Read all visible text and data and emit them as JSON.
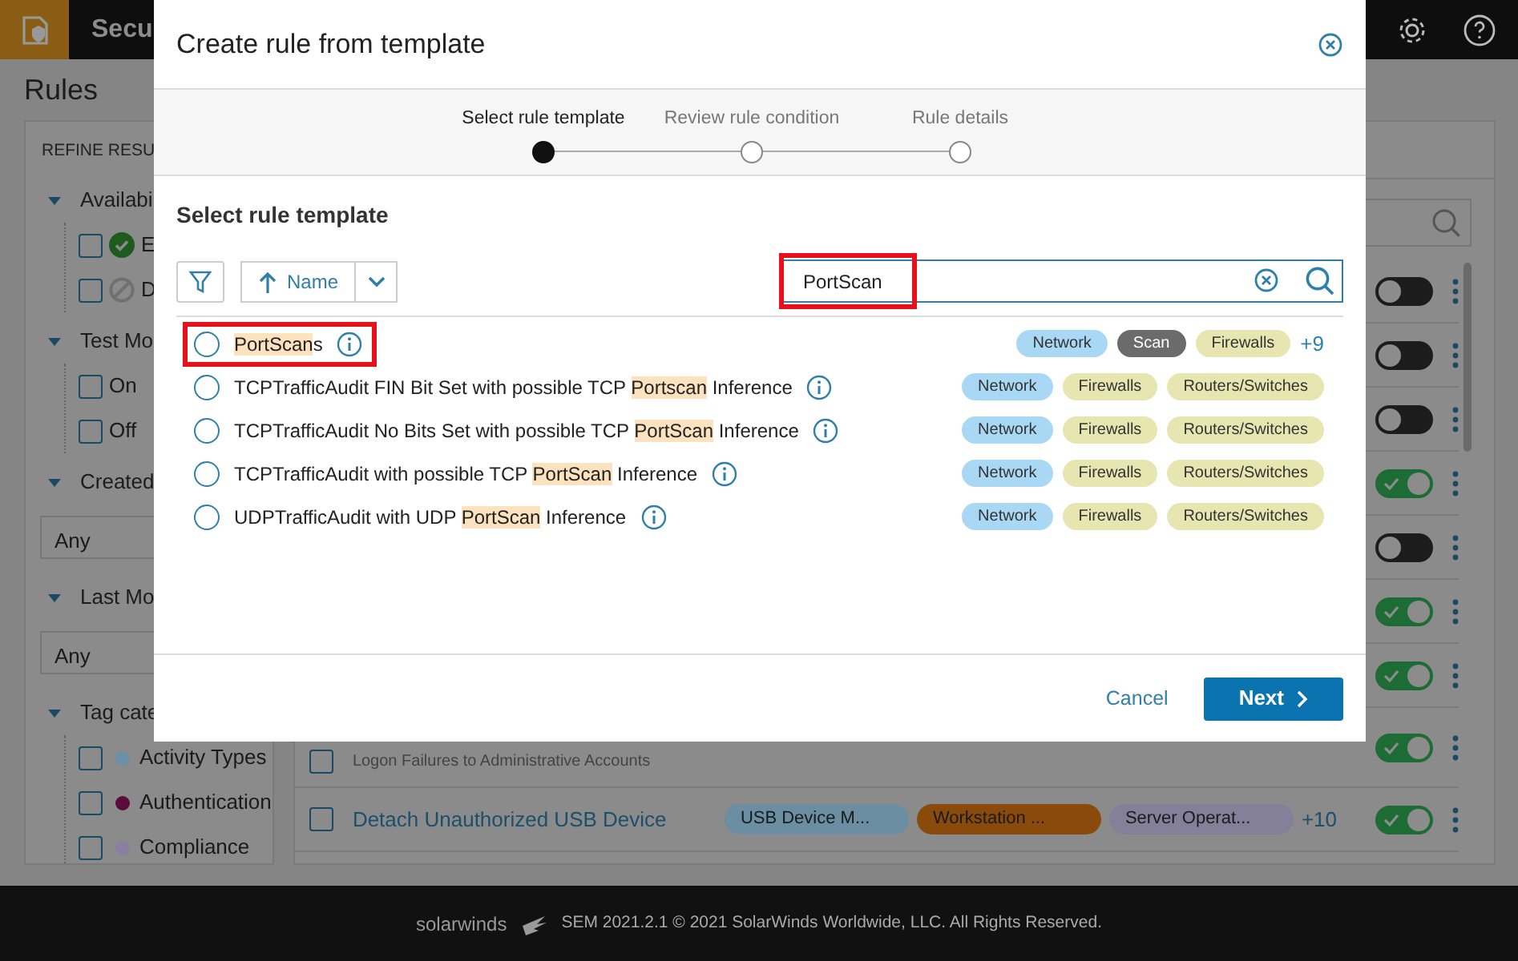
{
  "app": {
    "title": "Secu"
  },
  "page_title": "Rules",
  "refine": {
    "heading": "REFINE RESU",
    "groups": [
      {
        "label": "Availabi",
        "expanded": true,
        "kind": "checkboxes",
        "options": [
          {
            "label": "E",
            "checked": false,
            "enabled": true
          },
          {
            "label": "D",
            "checked": false,
            "enabled": false
          }
        ]
      },
      {
        "label": "Test Mo",
        "expanded": true,
        "kind": "checkboxes",
        "options": [
          {
            "label": "On",
            "checked": false
          },
          {
            "label": "Off",
            "checked": false
          }
        ]
      },
      {
        "label": "Created",
        "expanded": true,
        "kind": "select",
        "value": "Any"
      },
      {
        "label": "Last Mo",
        "expanded": true,
        "kind": "select",
        "value": "Any"
      },
      {
        "label": "Tag cate",
        "expanded": true,
        "kind": "checkboxes",
        "options": [
          {
            "label": "Activity Types",
            "checked": false,
            "color": "#6a8fa6"
          },
          {
            "label": "Authentication",
            "checked": false,
            "color": "#5c0c3a"
          },
          {
            "label": "Compliance",
            "checked": false,
            "color": "#8c7ea0"
          }
        ]
      }
    ]
  },
  "rules": [
    {
      "on": false
    },
    {
      "on": false
    },
    {
      "on": false
    },
    {
      "on": true
    },
    {
      "on": false
    },
    {
      "on": true
    },
    {
      "on": true
    },
    {
      "description": "Logon Failures to Administrative Accounts",
      "checked": false,
      "on": true
    },
    {
      "name": "Detach Unauthorized USB Device",
      "checked": false,
      "on": true,
      "more": "+10",
      "tags": [
        {
          "label": "USB Device M...",
          "color": "#6b8ea3"
        },
        {
          "label": "Workstation ...",
          "color": "#8a4a0c"
        },
        {
          "label": "Server Operat...",
          "color": "#84809a"
        }
      ]
    }
  ],
  "modal": {
    "title": "Create rule from template",
    "steps": [
      {
        "label": "Select rule template",
        "selected": true
      },
      {
        "label": "Review rule condition",
        "selected": false
      },
      {
        "label": "Rule details",
        "selected": false
      }
    ],
    "section_title": "Select rule template",
    "sort": {
      "label": "Name",
      "ascending": true
    },
    "search": {
      "value": "PortScan",
      "annotated": true
    },
    "templates": [
      {
        "selected": false,
        "annotated": true,
        "segments": [
          {
            "text": "PortScan",
            "highlight": true
          },
          {
            "text": "s",
            "highlight": false
          }
        ],
        "tags": [
          {
            "label": "Network",
            "color": "#a9d8f5"
          },
          {
            "label": "Scan",
            "color": "#6b6b6b"
          },
          {
            "label": "Firewalls",
            "color": "#e8e6b0"
          }
        ],
        "more": "+9"
      },
      {
        "selected": false,
        "annotated": false,
        "segments": [
          {
            "text": "TCPTrafficAudit FIN Bit Set with possible TCP ",
            "highlight": false
          },
          {
            "text": "Portscan",
            "highlight": true
          },
          {
            "text": " Inference",
            "highlight": false
          }
        ],
        "tags": [
          {
            "label": "Network",
            "color": "#a9d8f5"
          },
          {
            "label": "Firewalls",
            "color": "#e8e6b0"
          },
          {
            "label": "Routers/Switches",
            "color": "#e8e6b0"
          }
        ]
      },
      {
        "selected": false,
        "annotated": false,
        "segments": [
          {
            "text": "TCPTrafficAudit No Bits Set with possible TCP ",
            "highlight": false
          },
          {
            "text": "PortScan",
            "highlight": true
          },
          {
            "text": " Inference",
            "highlight": false
          }
        ],
        "tags": [
          {
            "label": "Network",
            "color": "#a9d8f5"
          },
          {
            "label": "Firewalls",
            "color": "#e8e6b0"
          },
          {
            "label": "Routers/Switches",
            "color": "#e8e6b0"
          }
        ]
      },
      {
        "selected": false,
        "annotated": false,
        "segments": [
          {
            "text": "TCPTrafficAudit with possible TCP ",
            "highlight": false
          },
          {
            "text": "PortScan",
            "highlight": true
          },
          {
            "text": " Inference",
            "highlight": false
          }
        ],
        "tags": [
          {
            "label": "Network",
            "color": "#a9d8f5"
          },
          {
            "label": "Firewalls",
            "color": "#e8e6b0"
          },
          {
            "label": "Routers/Switches",
            "color": "#e8e6b0"
          }
        ]
      },
      {
        "selected": false,
        "annotated": false,
        "segments": [
          {
            "text": "UDPTrafficAudit with UDP ",
            "highlight": false
          },
          {
            "text": "PortScan",
            "highlight": true
          },
          {
            "text": " Inference",
            "highlight": false
          }
        ],
        "tags": [
          {
            "label": "Network",
            "color": "#a9d8f5"
          },
          {
            "label": "Firewalls",
            "color": "#e8e6b0"
          },
          {
            "label": "Routers/Switches",
            "color": "#e8e6b0"
          }
        ]
      }
    ],
    "cancel_label": "Cancel",
    "next_label": "Next"
  },
  "footer": {
    "brand": "solarwinds",
    "copyright": "SEM 2021.2.1 © 2021 SolarWinds Worldwide, LLC. All Rights Reserved."
  }
}
